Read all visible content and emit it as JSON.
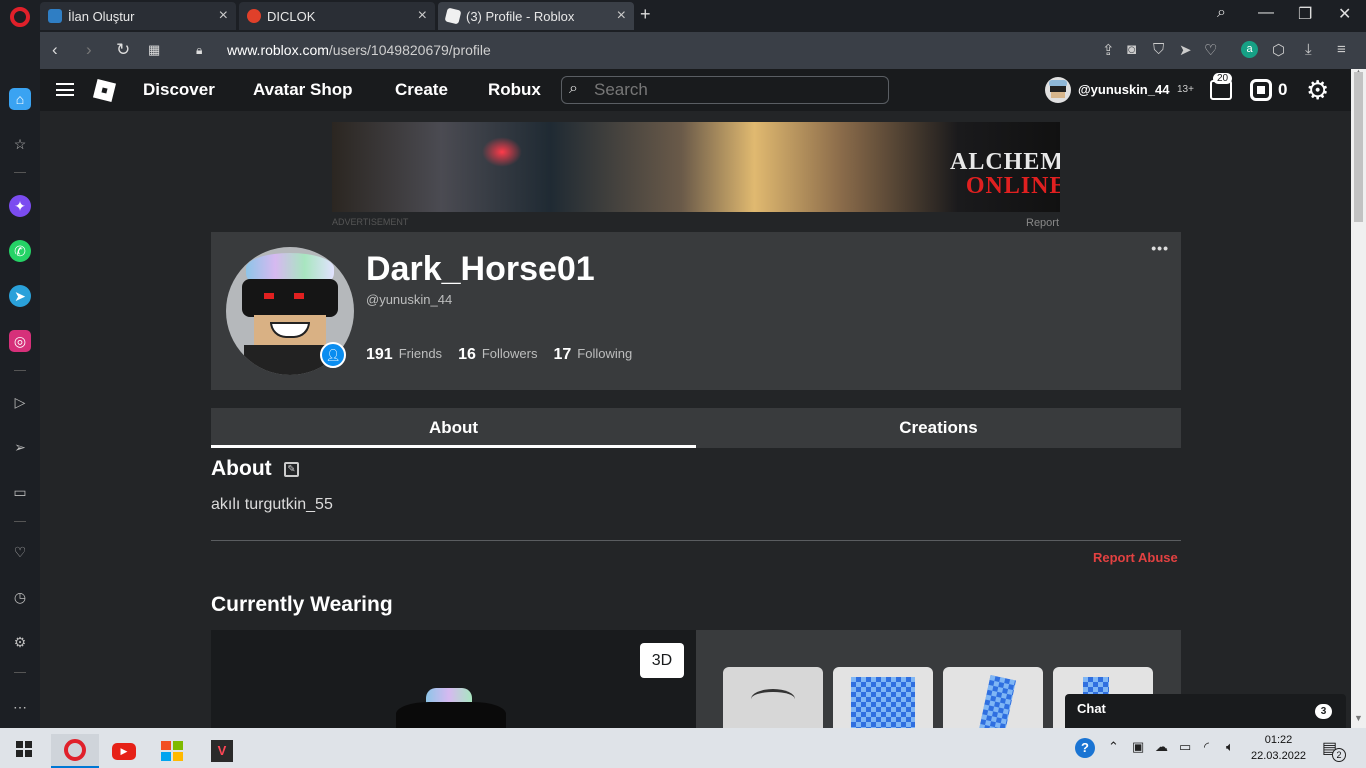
{
  "browser": {
    "tabs": [
      {
        "title": "İlan Oluştur",
        "favicon_color": "#2f7ec4"
      },
      {
        "title": "DICLOK",
        "favicon_color": "#e0402a"
      },
      {
        "title": "(3) Profile - Roblox",
        "favicon_color": "#f0f0f0"
      }
    ],
    "url_host": "www.roblox.com",
    "url_path": "/users/1049820679/profile"
  },
  "header": {
    "nav": [
      "Discover",
      "Avatar Shop",
      "Create",
      "Robux"
    ],
    "search_placeholder": "Search",
    "username": "@yunuskin_44",
    "age_badge": "13+",
    "notifications": "20",
    "robux": "0"
  },
  "ad": {
    "title_line1": "ALCHEMY",
    "title_line2": "ONLINE",
    "label": "ADVERTISEMENT",
    "report": "Report"
  },
  "profile": {
    "display_name": "Dark_Horse01",
    "handle": "@yunuskin_44",
    "friends": "191",
    "friends_label": "Friends",
    "followers": "16",
    "followers_label": "Followers",
    "following": "17",
    "following_label": "Following",
    "more": "•••"
  },
  "tabs": [
    "About",
    "Creations"
  ],
  "about": {
    "heading": "About",
    "text": "akılı turgutkin_55",
    "report_abuse": "Report Abuse"
  },
  "wearing": {
    "heading": "Currently Wearing",
    "button_3d": "3D"
  },
  "chat": {
    "label": "Chat",
    "count": "3"
  },
  "taskbar": {
    "time": "01:22",
    "date": "22.03.2022",
    "notifications": "2"
  },
  "colors": {
    "accent": "#0a8df0",
    "danger": "#e24141",
    "page_bg": "#232527",
    "card_bg": "#393b3d"
  }
}
